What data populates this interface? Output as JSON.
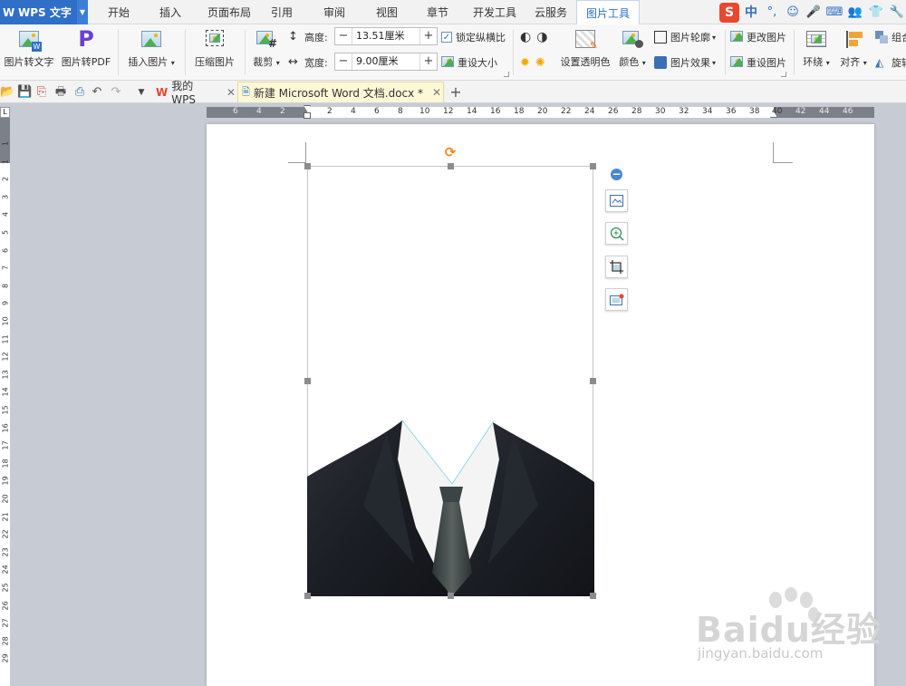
{
  "app": {
    "name": "WPS 文字",
    "logo_text": "W"
  },
  "menu_tabs": [
    "开始",
    "插入",
    "页面布局",
    "引用",
    "审阅",
    "视图",
    "章节",
    "开发工具",
    "云服务",
    "图片工具"
  ],
  "active_tab": "图片工具",
  "ime": {
    "logo": "S",
    "mode": "中"
  },
  "ribbon": {
    "pic_to_text": "图片转文字",
    "pic_to_pdf": "图片转PDF",
    "insert_picture": "插入图片",
    "compress_picture": "压缩图片",
    "crop": "裁剪",
    "height_label": "高度:",
    "height_value": "13.51厘米",
    "width_label": "宽度:",
    "width_value": "9.00厘米",
    "lock_ratio": "锁定纵横比",
    "reset_size": "重设大小",
    "set_transparent": "设置透明色",
    "color": "颜色",
    "picture_outline": "图片轮廓",
    "picture_effect": "图片效果",
    "change_picture": "更改图片",
    "reset_picture": "重设图片",
    "wrap": "环绕",
    "align": "对齐",
    "group": "组合",
    "rotate": "旋转"
  },
  "doc_tabs": [
    {
      "label": "我的WPS",
      "active": false
    },
    {
      "label": "新建 Microsoft Word 文档.docx *",
      "active": true
    }
  ],
  "ruler": {
    "h_left_ticks": [
      "6",
      "4",
      "2"
    ],
    "h_ticks": [
      "2",
      "4",
      "6",
      "8",
      "10",
      "12",
      "14",
      "16",
      "18",
      "20",
      "22",
      "24",
      "26",
      "28",
      "30",
      "32",
      "34",
      "36",
      "38",
      "40"
    ],
    "h_right_ticks": [
      "42",
      "44",
      "46"
    ],
    "v_ticks": [
      "1",
      "1",
      "2",
      "3",
      "4",
      "5",
      "6",
      "7",
      "8",
      "9",
      "10",
      "11",
      "12",
      "13",
      "14",
      "15",
      "16",
      "17",
      "18",
      "19",
      "20",
      "21",
      "22",
      "23",
      "24",
      "25",
      "26",
      "27",
      "28",
      "29"
    ]
  },
  "watermark": {
    "main": "Baidu经验",
    "sub": "jingyan.baidu.com"
  },
  "colors": {
    "accent": "#2f6fc8",
    "rotate_handle": "#f08a1c",
    "suit": "#1b1e24",
    "shirt": "#f4f4f4",
    "tie": "#3d4446"
  }
}
